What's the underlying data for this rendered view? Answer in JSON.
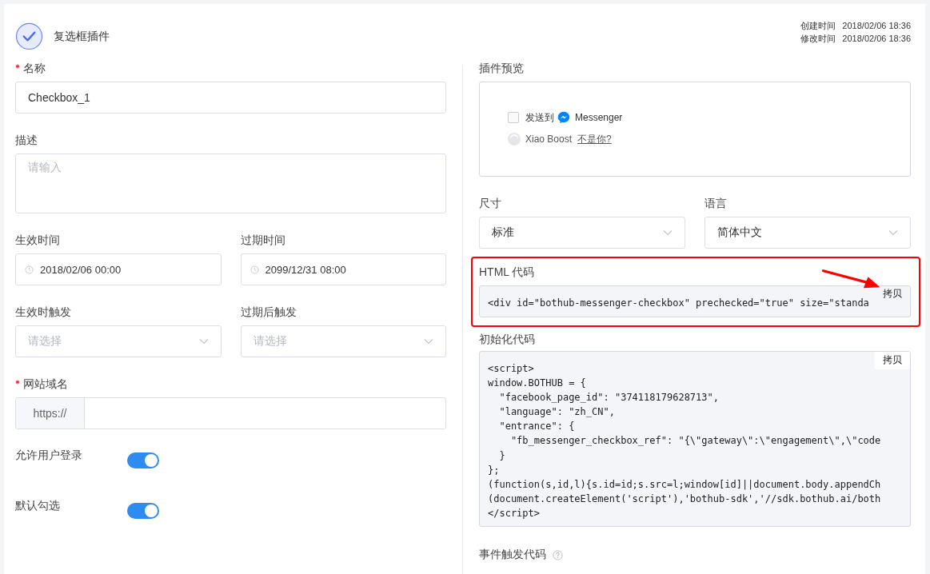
{
  "header": {
    "title": "复选框插件",
    "meta": [
      {
        "label": "创建时间",
        "value": "2018/02/06 18:36"
      },
      {
        "label": "修改时间",
        "value": "2018/02/06 18:36"
      }
    ]
  },
  "left_fields": [
    {
      "kind": "input",
      "label": "名称",
      "required": true,
      "value": "Checkbox_1"
    },
    {
      "kind": "textarea",
      "label": "描述",
      "required": false,
      "placeholder": "请输入"
    },
    {
      "kind": "pair",
      "items": [
        {
          "kind": "date",
          "label": "生效时间",
          "value": "2018/02/06 00:00"
        },
        {
          "kind": "date",
          "label": "过期时间",
          "value": "2099/12/31 08:00"
        }
      ]
    },
    {
      "kind": "pair",
      "items": [
        {
          "kind": "select",
          "label": "生效时触发",
          "placeholder": "请选择"
        },
        {
          "kind": "select",
          "label": "过期后触发",
          "placeholder": "请选择"
        }
      ]
    },
    {
      "kind": "prefix_input",
      "label": "网站域名",
      "required": true,
      "prefix": "https://"
    },
    {
      "kind": "toggle",
      "label": "允许用户登录",
      "on": true
    },
    {
      "kind": "toggle",
      "label": "默认勾选",
      "on": true
    }
  ],
  "preview": {
    "label": "插件预览",
    "checkbox": {
      "checked": false,
      "text": "发送到",
      "brand": "Messenger"
    },
    "user": {
      "name": "Xiao Boost",
      "link": "不是你?"
    }
  },
  "settings": [
    {
      "label": "尺寸",
      "value": "标准"
    },
    {
      "label": "语言",
      "value": "简体中文"
    }
  ],
  "html_code": {
    "label": "HTML 代码",
    "code": "<div id=\"bothub-messenger-checkbox\" prechecked=\"true\" size=\"standa",
    "copy": "拷贝",
    "highlighted": true
  },
  "init_code": {
    "label": "初始化代码",
    "copy": "拷贝",
    "lines": [
      "<script>",
      "window.BOTHUB = {",
      "  \"facebook_page_id\": \"374118179628713\",",
      "  \"language\": \"zh_CN\",",
      "  \"entrance\": {",
      "    \"fb_messenger_checkbox_ref\": \"{\\\"gateway\\\":\\\"engagement\\\",\\\"code",
      "  }",
      "};",
      "(function(s,id,l){s.id=id;s.src=l;window[id]||document.body.appendCh",
      "(document.createElement('script'),'bothub-sdk','//sdk.bothub.ai/both",
      "</script>"
    ]
  },
  "event_code": {
    "label": "事件触发代码"
  }
}
